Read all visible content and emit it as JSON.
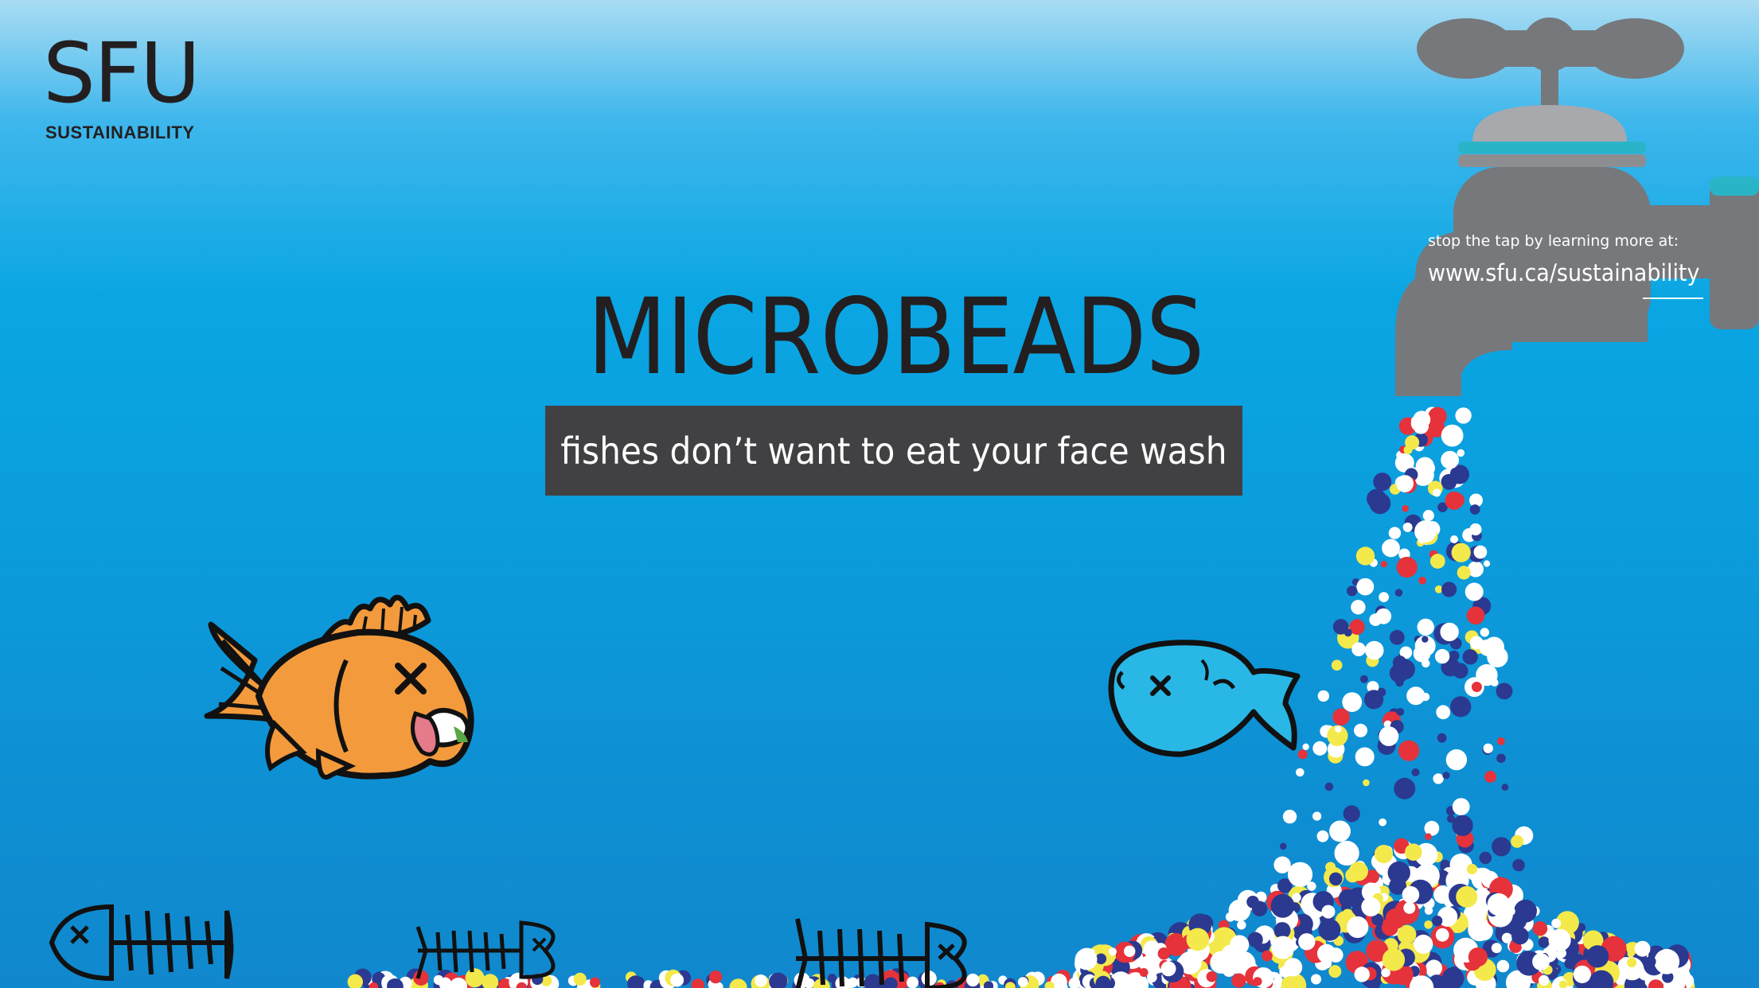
{
  "brand": {
    "logo_text": "SFU",
    "logo_subtitle": "SUSTAINABILITY"
  },
  "headline": "MICROBEADS",
  "tagline": "fishes don’t want to eat your face wash",
  "call_to_action": {
    "lead": "stop the tap by learning more at:",
    "url": "www.sfu.ca/sustainability"
  },
  "icons": [
    "faucet-icon",
    "dead-orange-fish-icon",
    "dead-blue-fish-icon",
    "fish-skeleton-icon",
    "microbead-icon"
  ],
  "colors": {
    "water_blue": "#0aa6e3",
    "dark_text": "#231f20",
    "tagline_bg": "#414042",
    "faucet_gray": "#77787b",
    "faucet_teal": "#29b4c8",
    "orange_fish": "#f39a3d",
    "blue_fish": "#29b7e6",
    "bead_white": "#ffffff",
    "bead_yellow": "#f4e94b",
    "bead_red": "#e5323b",
    "bead_navy": "#2b3990"
  }
}
